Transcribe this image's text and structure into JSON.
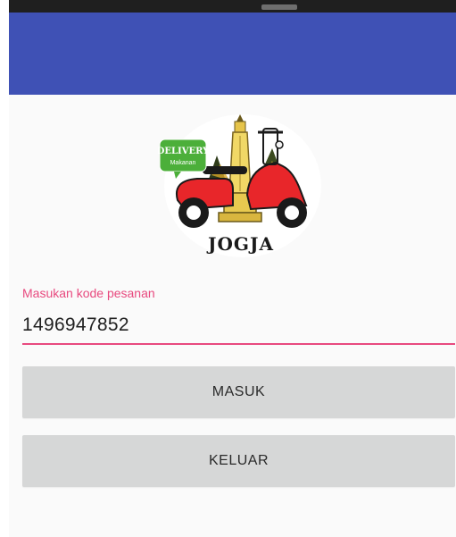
{
  "colors": {
    "toolbar": "#3f51b5",
    "accent": "#e84a7f",
    "button_bg": "#d6d7d7",
    "background": "#fafafa"
  },
  "logo": {
    "badge_line1": "DELIVERY",
    "badge_line2": "Makanan",
    "brand": "JOGJA",
    "icon": "scooter-monument-logo"
  },
  "form": {
    "label": "Masukan kode pesanan",
    "value": "1496947852"
  },
  "buttons": {
    "masuk": "MASUK",
    "keluar": "KELUAR"
  }
}
